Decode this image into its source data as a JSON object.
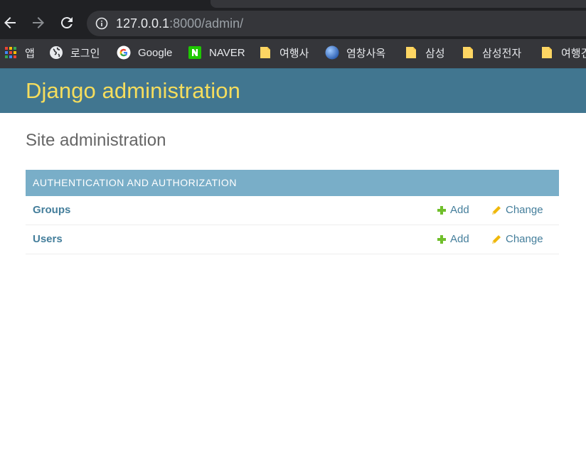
{
  "browser": {
    "url_host": "127.0.0.1",
    "url_path": ":8000/admin/"
  },
  "bookmarks": [
    {
      "label": "앱",
      "icon": "apps-grid-icon"
    },
    {
      "label": "로그인",
      "icon": "globe-icon"
    },
    {
      "label": "Google",
      "icon": "google-icon"
    },
    {
      "label": "NAVER",
      "icon": "naver-icon"
    },
    {
      "label": "여행사",
      "icon": "folder-icon"
    },
    {
      "label": "염창사옥",
      "icon": "globe-blue-icon"
    },
    {
      "label": "삼성",
      "icon": "folder-icon"
    },
    {
      "label": "삼성전자",
      "icon": "folder-icon"
    },
    {
      "label": "여행견",
      "icon": "folder-icon"
    }
  ],
  "admin": {
    "brand": "Django administration",
    "title": "Site administration",
    "module_caption": "AUTHENTICATION AND AUTHORIZATION",
    "rows": [
      {
        "name": "Groups",
        "add": "Add",
        "change": "Change"
      },
      {
        "name": "Users",
        "add": "Add",
        "change": "Change"
      }
    ]
  },
  "colors": {
    "header_bg": "#417690",
    "brand_text": "#f5dd5d",
    "caption_bg": "#79aec8",
    "link": "#447e9b",
    "add_icon": "#70bf2b",
    "change_icon": "#efb80b"
  }
}
